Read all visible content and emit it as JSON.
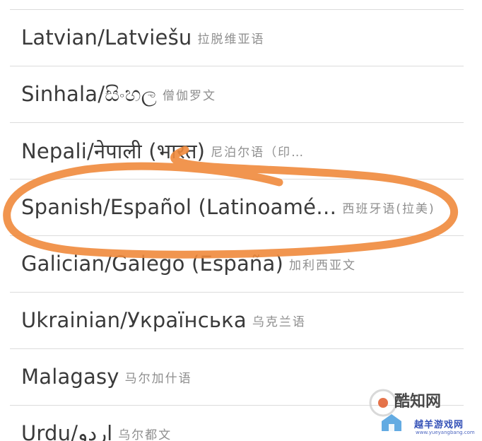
{
  "languages": [
    {
      "primary": "Latvian/Latviešu",
      "secondary": "拉脱维亚语"
    },
    {
      "primary": "Sinhala/සිංහල",
      "secondary": "僧伽罗文"
    },
    {
      "primary": "Nepali/नेपाली (भारत)",
      "secondary": "尼泊尔语（印…"
    },
    {
      "primary": "Spanish/Español (Latinoamé…",
      "secondary": "西班牙语(拉美)"
    },
    {
      "primary": "Galician/Galego (España)",
      "secondary": "加利西亚文"
    },
    {
      "primary": "Ukrainian/Українська",
      "secondary": "乌克兰语"
    },
    {
      "primary": "Malagasy",
      "secondary": "马尔加什语"
    },
    {
      "primary": "Urdu/اردو",
      "secondary": "乌尔都文"
    }
  ],
  "highlighted_index": 3,
  "annotation": {
    "color": "#f08a3c"
  },
  "watermark": {
    "line1": "酷知网",
    "line2": "越羊游戏网",
    "url": "www.yueyangbang.com",
    "logo_color": "#e05a2a"
  }
}
